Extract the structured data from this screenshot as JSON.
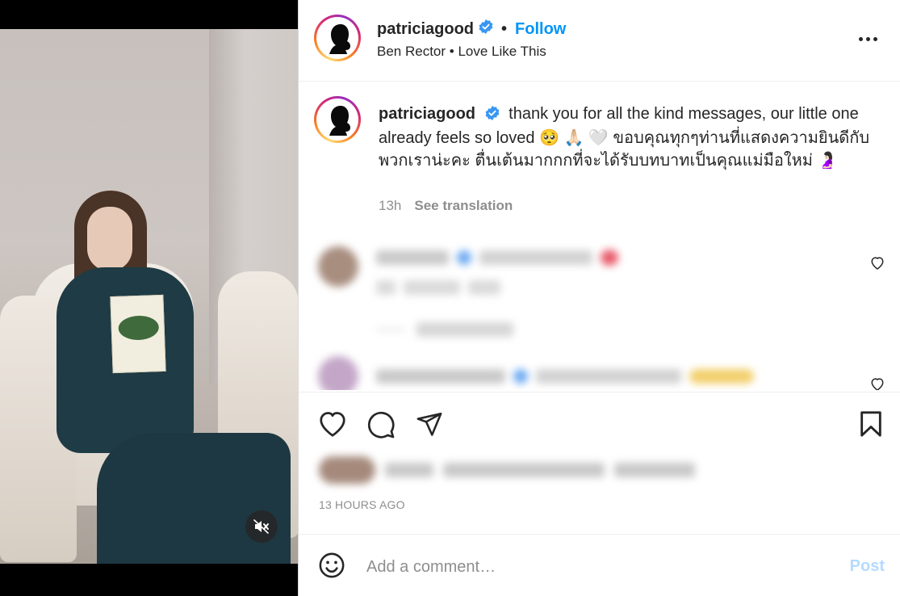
{
  "post": {
    "username": "patriciagood",
    "follow_label": "Follow",
    "audio": "Ben Rector • Love Like This"
  },
  "caption": {
    "username": "patriciagood",
    "text": "thank you for all the kind messages, our little one already feels so loved 🥺 🙏🏻 🤍 ขอบคุณทุกๆท่านที่แสดงความยินดีกับพวกเราน่ะคะ ตื่นเต้นมากกกที่จะได้รับบทบาทเป็นคุณแม่มือใหม่ 🤰🏻",
    "age": "13h",
    "see_translation": "See translation"
  },
  "footer": {
    "timestamp": "13 HOURS AGO",
    "comment_placeholder": "Add a comment…",
    "post_label": "Post"
  },
  "icons": {
    "verified": "verified-badge-icon",
    "more": "more-options-icon",
    "like": "heart-icon",
    "comment": "comment-icon",
    "share": "share-icon",
    "save": "bookmark-icon",
    "mute": "muted-speaker-icon",
    "emoji": "emoji-icon"
  },
  "colors": {
    "accent": "#0095f6",
    "post_disabled": "#b3dbff",
    "muted_text": "#8e8e8e",
    "verified": "#3897f0"
  }
}
